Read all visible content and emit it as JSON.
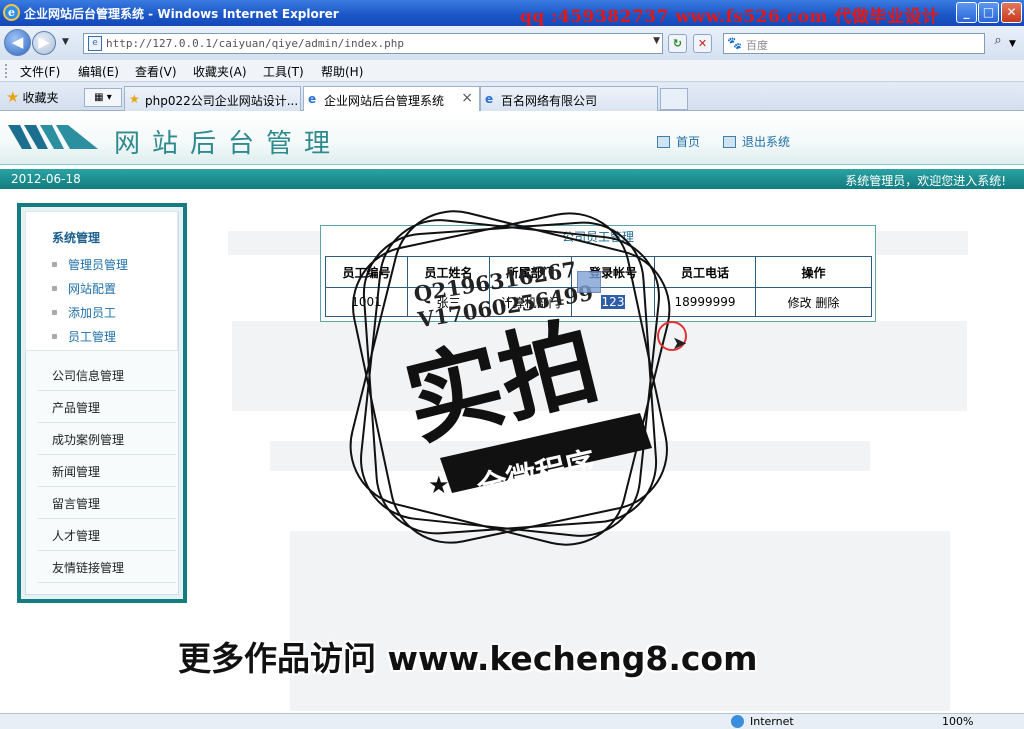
{
  "window": {
    "title": "企业网站后台管理系统 - Windows Internet Explorer",
    "overlay_ad": "qq :459382737 www.fs526.com 代做毕业设计",
    "buttons": {
      "minimize": "_",
      "maximize": "□",
      "close": "✕"
    }
  },
  "addressbar": {
    "url": "http://127.0.0.1/caiyuan/qiye/admin/index.php",
    "search_placeholder": "百度"
  },
  "menu": [
    "文件(F)",
    "编辑(E)",
    "查看(V)",
    "收藏夹(A)",
    "工具(T)",
    "帮助(H)"
  ],
  "favorites_label": "收藏夹",
  "tabs": [
    {
      "label": "php022公司企业网站设计...",
      "active": false
    },
    {
      "label": "企业网站后台管理系统",
      "active": true
    },
    {
      "label": "百名网络有限公司",
      "active": false
    }
  ],
  "header": {
    "site_title": "网站后台管理",
    "home_link": "首页",
    "logout_link": "退出系统",
    "date": "2012-06-18",
    "welcome": "系统管理员，欢迎您进入系统!"
  },
  "sidebar": {
    "group_title": "系统管理",
    "sub_items": [
      "管理员管理",
      "网站配置",
      "添加员工",
      "员工管理"
    ],
    "items": [
      "公司信息管理",
      "产品管理",
      "成功案例管理",
      "新闻管理",
      "留言管理",
      "人才管理",
      "友情链接管理"
    ]
  },
  "panel": {
    "title": "公司员工管理",
    "columns": [
      "员工编号",
      "员工姓名",
      "所属部门",
      "登录帐号",
      "员工电话",
      "操作"
    ],
    "rows": [
      {
        "id": "1001",
        "name": "张三",
        "dept": "计算机部门",
        "account": "123",
        "phone": "18999999",
        "edit": "修改",
        "delete": "删除"
      }
    ]
  },
  "watermarks": {
    "qq_line1": "Q2196316267",
    "qq_line2": "V17060256499",
    "stamp_big": "实拍",
    "stamp_ribbon": "全微程序",
    "bottom": "更多作品访问 www.kecheng8.com"
  },
  "statusbar": {
    "zone": "Internet",
    "zoom": "100%"
  }
}
